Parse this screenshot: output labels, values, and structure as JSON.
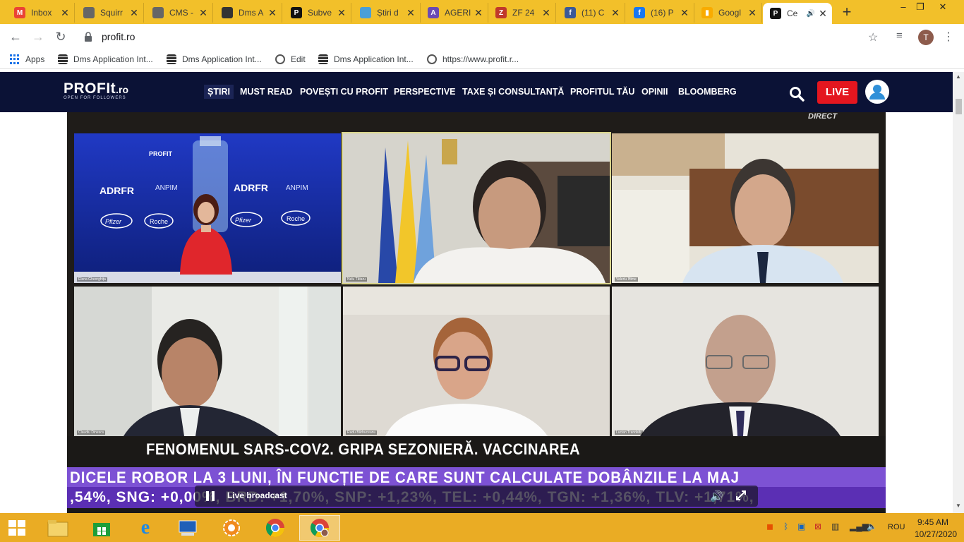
{
  "browser": {
    "tabs": [
      {
        "label": "Inbox",
        "icon": "gmail-icon",
        "color": "#ea4335",
        "glyph": "M"
      },
      {
        "label": "Squirr",
        "icon": "globe-icon",
        "color": "#666666",
        "glyph": ""
      },
      {
        "label": "CMS -",
        "icon": "globe-icon",
        "color": "#666666",
        "glyph": ""
      },
      {
        "label": "Dms A",
        "icon": "database-icon",
        "color": "#333333",
        "glyph": ""
      },
      {
        "label": "Subve",
        "icon": "profit-icon",
        "color": "#111111",
        "glyph": "P"
      },
      {
        "label": "Știri d",
        "icon": "news-icon",
        "color": "#4a9fd8",
        "glyph": ""
      },
      {
        "label": "AGERI",
        "icon": "agerpres-icon",
        "color": "#6a4ab4",
        "glyph": "A"
      },
      {
        "label": "ZF 24",
        "icon": "zf-icon",
        "color": "#c0392b",
        "glyph": "Z"
      },
      {
        "label": "(11) C",
        "icon": "facebook-icon",
        "color": "#3b5998",
        "glyph": "f"
      },
      {
        "label": "(16) P",
        "icon": "facebook-icon",
        "color": "#1877f2",
        "glyph": "f"
      },
      {
        "label": "Googl",
        "icon": "analytics-icon",
        "color": "#f9ab00",
        "glyph": "▮"
      },
      {
        "label": "Ce",
        "icon": "profit-icon",
        "color": "#111111",
        "glyph": "P",
        "active": true
      }
    ],
    "url": "profit.ro",
    "profile_initial": "T",
    "bookmarks": [
      {
        "label": "Apps",
        "icon": "apps-icon"
      },
      {
        "label": "Dms Application Int...",
        "icon": "database-icon"
      },
      {
        "label": "Dms Application Int...",
        "icon": "database-icon"
      },
      {
        "label": "Edit",
        "icon": "globe-icon"
      },
      {
        "label": "Dms Application Int...",
        "icon": "database-icon"
      },
      {
        "label": "https://www.profit.r...",
        "icon": "globe-icon"
      }
    ]
  },
  "site": {
    "logo": "PROFIt",
    "logo_tld": ".ro",
    "logo_tagline": "OPEN FOR FOLLOWERS",
    "nav": [
      "ȘTIRI",
      "MUST READ",
      "POVEȘTI CU PROFIT",
      "PERSPECTIVE",
      "TAXE ȘI CONSULTANȚĂ",
      "PROFITUL TĂU",
      "OPINII",
      "BLOOMBERG"
    ],
    "live_label": "LIVE"
  },
  "video": {
    "direct_label": "DIRECT",
    "participants": [
      {
        "name": "Elena Gheorghița"
      },
      {
        "name": "Nelu Tătaru"
      },
      {
        "name": "Valeriu Iftime"
      },
      {
        "name": "Claudiu Dinescu"
      },
      {
        "name": "Radu Bărbuceanu"
      },
      {
        "name": "Lucian Trandafir"
      }
    ],
    "backdrop_brands": [
      "PROFIT",
      "ADRFR",
      "ANPIM",
      "Pfizer",
      "Roche"
    ],
    "caption": "FENOMENUL SARS-COV2. GRIPA SEZONIERĂ. VACCINAREA",
    "ticker_top": "DICELE ROBOR LA 3 LUNI, ÎN FUNCȚIE DE CARE SUNT CALCULATE DOBÂNZILE LA MAJ",
    "ticker_bottom": ",54%, SNG: +0,00%, BRD: +1,70%, SNP: +1,23%, TEL: +0,44%, TGN: +1,36%, TLV: +1,71%,",
    "player_label": "Live broadcast"
  },
  "taskbar": {
    "lang": "ROU",
    "time": "9:45 AM",
    "date": "10/27/2020"
  }
}
